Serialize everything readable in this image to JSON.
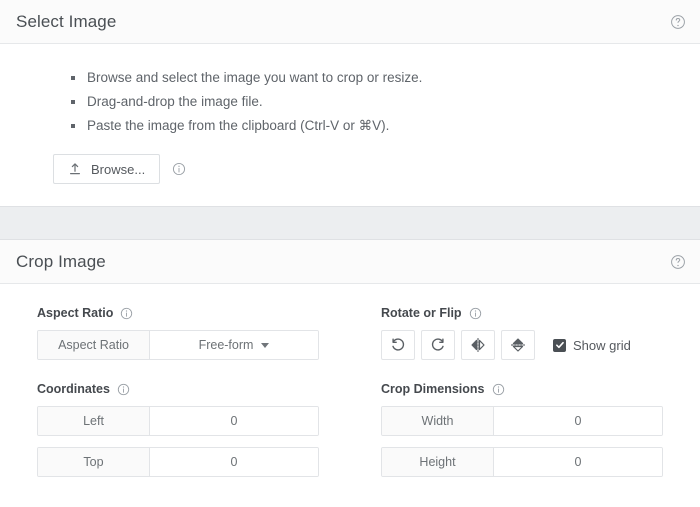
{
  "select_image": {
    "title": "Select Image",
    "help_icon": "help-circle-icon",
    "instructions": [
      "Browse and select the image you want to crop or resize.",
      "Drag-and-drop the image file.",
      "Paste the image from the clipboard (Ctrl-V or ⌘V)."
    ],
    "browse_button": {
      "label": "Browse...",
      "icon": "upload-icon"
    },
    "browse_info_icon": "info-circle-icon"
  },
  "crop_image": {
    "title": "Crop Image",
    "help_icon": "help-circle-icon",
    "aspect_ratio": {
      "label": "Aspect Ratio",
      "info_icon": "info-circle-icon",
      "addon": "Aspect Ratio",
      "value": "Free-form"
    },
    "rotate_or_flip": {
      "label": "Rotate or Flip",
      "info_icon": "info-circle-icon",
      "buttons": [
        {
          "name": "rotate-left-button",
          "icon": "rotate-counter-clockwise-icon"
        },
        {
          "name": "rotate-right-button",
          "icon": "rotate-clockwise-icon"
        },
        {
          "name": "flip-horizontal-button",
          "icon": "flip-horizontal-icon"
        },
        {
          "name": "flip-vertical-button",
          "icon": "flip-vertical-icon"
        }
      ],
      "show_grid": {
        "label": "Show grid",
        "checked": true
      }
    },
    "coordinates": {
      "label": "Coordinates",
      "info_icon": "info-circle-icon",
      "fields": [
        {
          "addon": "Left",
          "value": "0"
        },
        {
          "addon": "Top",
          "value": "0"
        }
      ]
    },
    "crop_dimensions": {
      "label": "Crop Dimensions",
      "info_icon": "info-circle-icon",
      "fields": [
        {
          "addon": "Width",
          "value": "0"
        },
        {
          "addon": "Height",
          "value": "0"
        }
      ]
    }
  },
  "colors": {
    "panel_header_bg": "#fbfbfb",
    "gap_strip_bg": "#eceef0",
    "border": "#e2e4e7",
    "text": "#5f646a",
    "heading": "#45494e",
    "checkbox_fill": "#4a4f54"
  }
}
